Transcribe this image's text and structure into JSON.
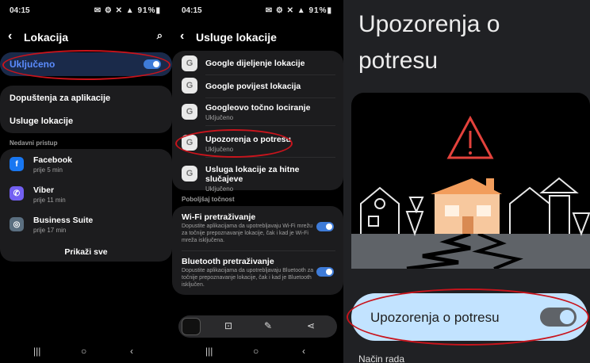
{
  "screen1": {
    "status": {
      "time": "04:15",
      "icons": "✉ ⚙ ✕ ▲ 91%▮"
    },
    "title": "Lokacija",
    "toggle_label": "Uključeno",
    "menu": [
      "Dopuštenja za aplikacije",
      "Usluge lokacije"
    ],
    "recent_header": "Nedavni pristup",
    "apps": [
      {
        "name": "Facebook",
        "time": "prije 5 min",
        "icon": "f",
        "color": "#1877f2"
      },
      {
        "name": "Viber",
        "time": "prije 11 min",
        "icon": "✆",
        "color": "#7360f2"
      },
      {
        "name": "Business Suite",
        "time": "prije 17 min",
        "icon": "◎",
        "color": "#5b6f80"
      }
    ],
    "show_all": "Prikaži sve"
  },
  "screen2": {
    "status": {
      "time": "04:15",
      "icons": "✉ ⚙ ✕ ▲ 91%▮"
    },
    "title": "Usluge lokacije",
    "services": [
      {
        "label": "Google dijeljenje lokacije",
        "sub": ""
      },
      {
        "label": "Google povijest lokacija",
        "sub": ""
      },
      {
        "label": "Googleovo točno lociranje",
        "sub": "Uključeno"
      },
      {
        "label": "Upozorenja o potresu",
        "sub": "Uključeno"
      },
      {
        "label": "Usluga lokacije za hitne slučajeve",
        "sub": "Uključeno"
      }
    ],
    "accuracy_header": "Poboljšaj točnost",
    "wifi": {
      "title": "Wi-Fi pretraživanje",
      "desc": "Dopustite aplikacijama da upotrebljavaju Wi-Fi mrežu za točnije prepoznavanje lokacije, čak i kad je Wi-Fi mreža isključena."
    },
    "bt": {
      "title": "Bluetooth pretraživanje",
      "desc": "Dopustite aplikacijama da upotrebljavaju Bluetooth za točnije prepoznavanje lokacije, čak i kad je Bluetooth isključen."
    }
  },
  "screen3": {
    "title_line1": "Upozorenja o",
    "title_line2": "potresu",
    "toggle_label": "Upozorenja o potresu",
    "mode_label": "Način rada"
  },
  "colors": {
    "accent": "#3e7bd8",
    "annotation": "#c8141c",
    "house": "#f7c89e",
    "roof": "#f29d5c",
    "warning": "#e3423c",
    "toggle_card": "#c2e3ff"
  }
}
